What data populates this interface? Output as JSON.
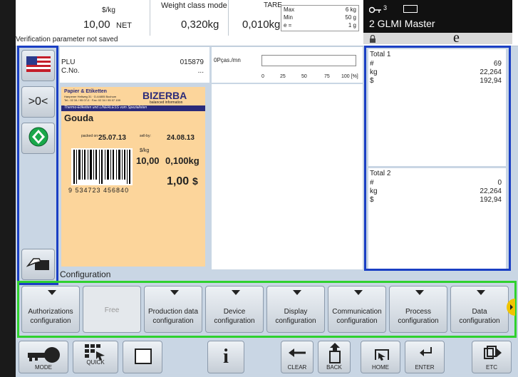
{
  "header": {
    "currency_unit": "$/kg",
    "price": "10,00",
    "net_label": "NET",
    "weight_class_label": "Weight class mode",
    "weight": "0,320kg",
    "tare_label": "TARE",
    "tare": "0,010kg",
    "max_label": "Max",
    "max_val": "6 kg",
    "min_label": "Min",
    "min_val": "50 g",
    "e_label": "e =",
    "e_val": "1 g",
    "key_count": "3",
    "device_name": "2 GLMI Master",
    "e_mark": "e",
    "warning": "Verification parameter not saved"
  },
  "plu": {
    "plu_label": "PLU",
    "plu_value": "015879",
    "cno_label": "C.No.",
    "cno_value": "...",
    "chart_label": "0Pças./mn",
    "ticks": [
      "0",
      "25",
      "50",
      "75",
      "100 [%]"
    ]
  },
  "label": {
    "company": "Papier & Etiketten",
    "address": "Hanpener Hellweg 31 · D-44805 Bochum",
    "phone": "Tel.: 02 34 / 95 07-0 · Fax: 02 34 / 95 07 199",
    "brand": "BIZERBA",
    "tagline": "balanced information",
    "sub": "Thermo-Etiketten und LINERLESS vom Spezialisten",
    "product": "Gouda",
    "packed_label": "packed on:",
    "packed_date": "25.07.13",
    "sell_label": "sell-by:",
    "sell_date": "24.08.13",
    "unit_price_label": "$/kg",
    "unit_price": "10,00",
    "weight": "0,100kg",
    "total": "1,00",
    "currency": "$",
    "barcode_digits": "9 534723 456840"
  },
  "totals": {
    "total1_label": "Total 1",
    "total1_rows": [
      [
        "#",
        "69"
      ],
      [
        "kg",
        "22,264"
      ],
      [
        "$",
        "192,94"
      ]
    ],
    "total2_label": "Total 2",
    "total2_rows": [
      [
        "#",
        "0"
      ],
      [
        "kg",
        "22,264"
      ],
      [
        "$",
        "192,94"
      ]
    ]
  },
  "config": {
    "title": "Configuration",
    "buttons": [
      "Authorizations configuration",
      "Free",
      "Production data configuration",
      "Device configuration",
      "Display configuration",
      "Communication configuration",
      "Process configuration",
      "Data configuration"
    ]
  },
  "bottom": {
    "mode": "MODE",
    "quick": "QUICK",
    "info": "i",
    "clear": "CLEAR",
    "back": "BACK",
    "home": "HOME",
    "enter": "ENTER",
    "etc": "ETC"
  }
}
